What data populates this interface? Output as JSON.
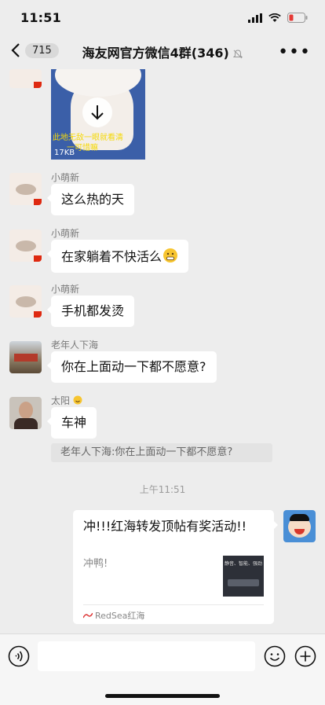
{
  "status": {
    "time": "11:51"
  },
  "nav": {
    "back_count": "715",
    "title": "海友网官方微信4群(346)"
  },
  "media": {
    "size": "17KB",
    "overlay_line1": "此地无敌一眼就看清",
    "overlay_line2": "一可惜嘛"
  },
  "messages": [
    {
      "sender": "小萌新",
      "text": "这么热的天"
    },
    {
      "sender": "小萌新",
      "text": "在家躺着不快活么"
    },
    {
      "sender": "小萌新",
      "text": "手机都发烫"
    },
    {
      "sender": "老年人下海",
      "text": "你在上面动一下都不愿意?"
    },
    {
      "sender": "太阳",
      "text": "车神"
    }
  ],
  "quote": "老年人下海:你在上面动一下都不愿意?",
  "timestamp": "上午11:51",
  "card": {
    "title": "冲!!!红海转发顶帖有奖活动!!",
    "description": "冲鸭!",
    "source": "RedSea红海",
    "thumb_text": "静音、智能、强劲"
  },
  "colors": {
    "accent_red": "#de2910",
    "background": "#ededed"
  }
}
